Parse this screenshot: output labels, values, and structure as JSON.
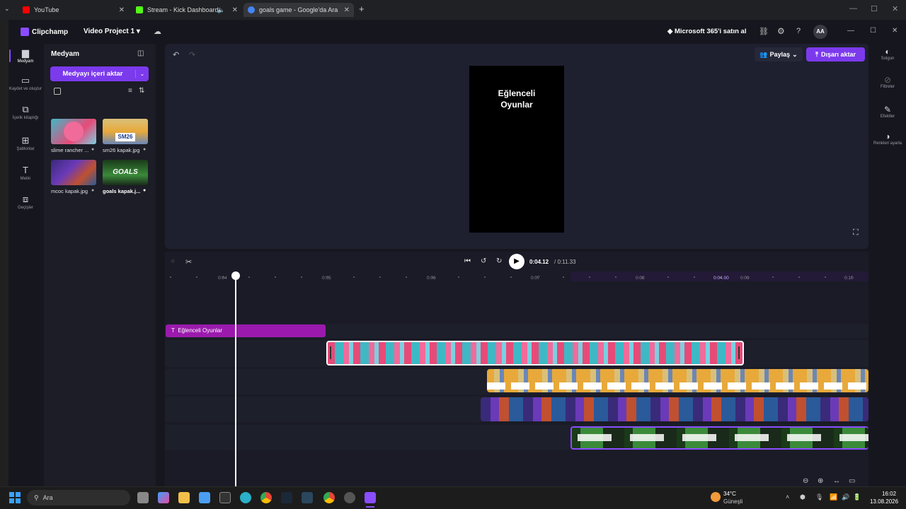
{
  "browser": {
    "tabs": [
      {
        "label": "YouTube",
        "color": "#ff0000"
      },
      {
        "label": "Stream - Kick Dashboard",
        "color": "#53fc18"
      },
      {
        "label": "goals game - Google'da Ara",
        "color": "#4285f4"
      }
    ],
    "new_tab": "+"
  },
  "app": {
    "name": "Clipchamp",
    "project": "Video Project 1",
    "ms365": "Microsoft 365'i satın al",
    "avatar": "AA",
    "share": "Paylaş",
    "export": "Dışarı aktar"
  },
  "leftnav": [
    {
      "label": "Medyam",
      "icon": "folder-icon"
    },
    {
      "label": "Kaydet ve oluştur",
      "icon": "camera-icon"
    },
    {
      "label": "İçerik kitaplığı",
      "icon": "library-icon"
    },
    {
      "label": "Şablonlar",
      "icon": "templates-icon"
    },
    {
      "label": "Metin",
      "icon": "text-icon"
    },
    {
      "label": "Geçişler",
      "icon": "transitions-icon"
    }
  ],
  "media": {
    "title": "Medyam",
    "import": "Medyayı içeri aktar",
    "items": [
      {
        "label": "slime rancher ..."
      },
      {
        "label": "sm26 kapak.jpg"
      },
      {
        "label": "mcoc kapak.jpg"
      },
      {
        "label": "goals kapak.j..."
      }
    ]
  },
  "preview": {
    "title_text": "Eğlenceli\nOyunlar"
  },
  "player": {
    "current": "0:04.12",
    "total": "/ 0:11.33"
  },
  "ruler": {
    "ticks": [
      "0:04",
      "0:05",
      "0:06",
      "0:07",
      "0:08",
      "0:09",
      "0:10"
    ],
    "marker": "0:04.00"
  },
  "text_clip": "Eğlenceli Oyunlar",
  "rightbar": [
    {
      "label": "Solgun",
      "icon": "fade-icon"
    },
    {
      "label": "Filtreler",
      "icon": "filter-icon"
    },
    {
      "label": "Efektler",
      "icon": "effects-icon"
    },
    {
      "label": "Renkleri ayarla",
      "icon": "color-icon"
    }
  ],
  "taskbar": {
    "search": "Ara",
    "weather_temp": "34°C",
    "weather_desc": "Güneşli",
    "time": "16:02",
    "date": "13.08.2026"
  }
}
